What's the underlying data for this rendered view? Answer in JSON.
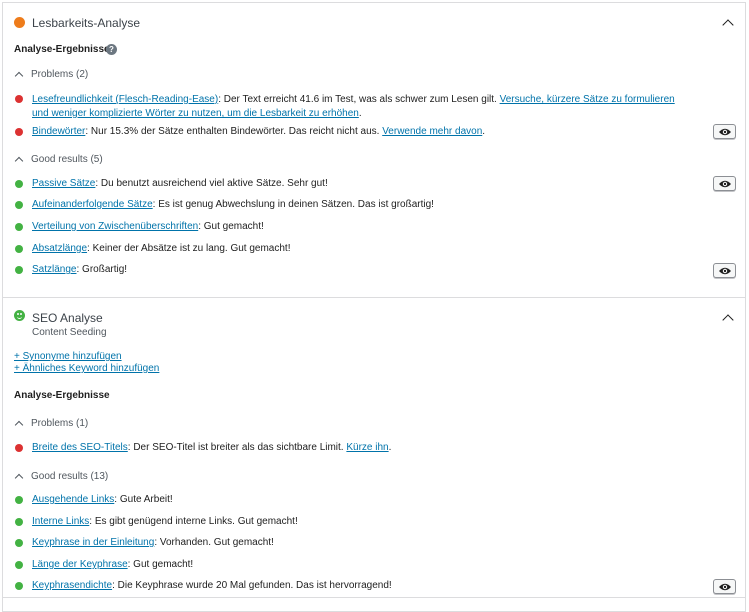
{
  "readability": {
    "title": "Lesbarkeits-Analyse",
    "results_heading": "Analyse-Ergebnisse",
    "help_icon": "help-icon",
    "problems_label": "Problems (2)",
    "problems": [
      {
        "link": "Lesefreundlichkeit (Flesch-Reading-Ease)",
        "text": ": Der Text erreicht 41.6 im Test, was als schwer zum Lesen gilt. ",
        "action": "Versuche, kürzere Sätze zu formulieren und weniger komplizierte Wörter zu nutzen, um die Lesbarkeit zu erhöhen",
        "suffix": ".",
        "status": "red"
      },
      {
        "link": "Bindewörter",
        "text": ": Nur 15.3% der Sätze enthalten Bindewörter. Das reicht nicht aus. ",
        "action": "Verwende mehr davon",
        "suffix": ".",
        "status": "red"
      }
    ],
    "good_label": "Good results (5)",
    "good": [
      {
        "link": "Passive Sätze",
        "text": ": Du benutzt ausreichend viel aktive Sätze. Sehr gut!",
        "status": "green"
      },
      {
        "link": "Aufeinanderfolgende Sätze",
        "text": ": Es ist genug Abwechslung in deinen Sätzen. Das ist großartig!",
        "status": "green"
      },
      {
        "link": "Verteilung von Zwischenüberschriften",
        "text": ": Gut gemacht!",
        "status": "green"
      },
      {
        "link": "Absatzlänge",
        "text": ": Keiner der Absätze ist zu lang. Gut gemacht!",
        "status": "green"
      },
      {
        "link": "Satzlänge",
        "text": ": Großartig!",
        "status": "green"
      }
    ]
  },
  "seo": {
    "title": "SEO Analyse",
    "keyphrase": "Content Seeding",
    "add_synonyms": "+ Synonyme hinzufügen",
    "add_related": "+ Ähnliches Keyword hinzufügen",
    "results_heading": "Analyse-Ergebnisse",
    "problems_label": "Problems (1)",
    "problems": [
      {
        "link": "Breite des SEO-Titels",
        "text": ": Der SEO-Titel ist breiter als das sichtbare Limit. ",
        "action": "Kürze ihn",
        "suffix": ".",
        "status": "red"
      }
    ],
    "good_label": "Good results (13)",
    "good": [
      {
        "link": "Ausgehende Links",
        "text": ": Gute Arbeit!",
        "status": "green"
      },
      {
        "link": "Interne Links",
        "text": ": Es gibt genügend interne Links. Gut gemacht!",
        "status": "green"
      },
      {
        "link": "Keyphrase in der Einleitung",
        "text": ": Vorhanden. Gut gemacht!",
        "status": "green"
      },
      {
        "link": "Länge der Keyphrase",
        "text": ": Gut gemacht!",
        "status": "green"
      },
      {
        "link": "Keyphrasendichte",
        "text": ": Die Keyphrase wurde 20 Mal gefunden. Das ist hervorragend!",
        "status": "green"
      }
    ]
  },
  "colors": {
    "problem": "#dc3232",
    "good": "#43b243",
    "score_orange": "#ee7c1b",
    "link": "#0073aa"
  },
  "icons": {
    "collapse": "chevron-up-icon",
    "mark": "eye-icon"
  }
}
